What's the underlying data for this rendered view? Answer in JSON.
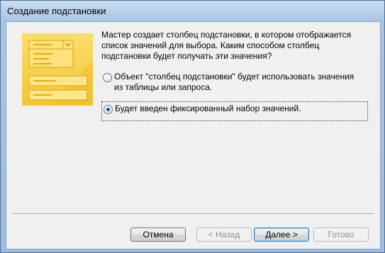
{
  "window": {
    "title": "Создание подстановки"
  },
  "intro_text": "Мастер создает столбец подстановки, в котором отображается список значений для выбора.  Каким способом столбец подстановки будет получать эти значения?",
  "options": [
    {
      "label": "Объект \"столбец подстановки\" будет использовать значения из таблицы или запроса.",
      "selected": false
    },
    {
      "label": "Будет введен фиксированный набор значений.",
      "selected": true
    }
  ],
  "buttons": {
    "cancel": "Отмена",
    "back": "< Назад",
    "next": "Далее >",
    "finish": "Готово"
  },
  "colors": {
    "illustration_yellow": "#f7cf3f",
    "illustration_dark": "#e8b817",
    "title_gradient_top": "#c9dcef"
  }
}
